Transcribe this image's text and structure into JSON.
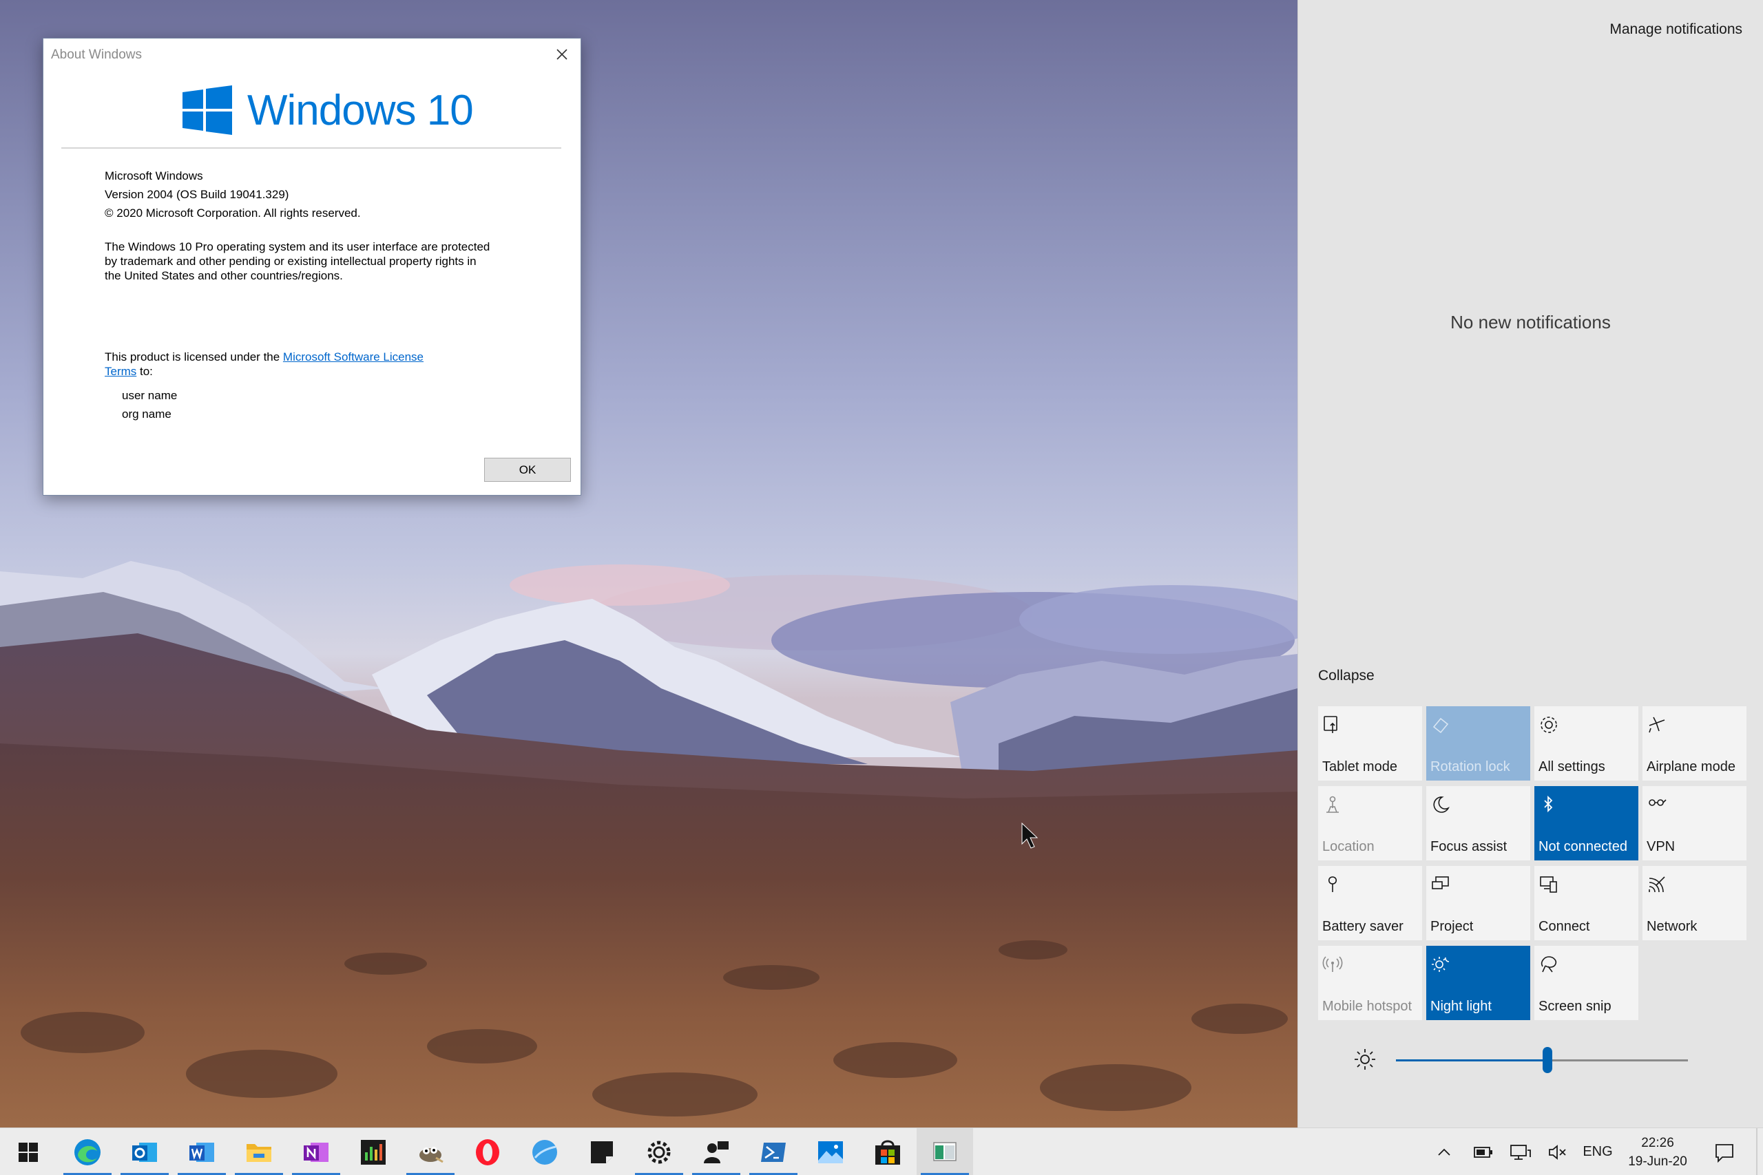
{
  "about_dialog": {
    "title": "About Windows",
    "logo_text": "Windows 10",
    "product": "Microsoft Windows",
    "version": "Version 2004 (OS Build 19041.329)",
    "copyright": "© 2020 Microsoft Corporation. All rights reserved.",
    "legal_line1": "The Windows 10 Pro operating system and its user interface are protected",
    "legal_line2": "by trademark and other pending or existing intellectual property rights in",
    "legal_line3": "the United States and other countries/regions.",
    "license_prefix": "This product is licensed under the ",
    "license_link_1": "Microsoft Software License",
    "license_link_2": "Terms",
    "license_suffix": " to:",
    "user_name": "user name",
    "org_name": "org name",
    "ok_label": "OK"
  },
  "action_center": {
    "manage_notifications": "Manage notifications",
    "no_notifications": "No new notifications",
    "collapse": "Collapse",
    "tiles": [
      {
        "label": "Tablet mode",
        "icon": "tablet-mode-icon",
        "state": "off"
      },
      {
        "label": "Rotation lock",
        "icon": "rotation-lock-icon",
        "state": "disabled-on"
      },
      {
        "label": "All settings",
        "icon": "gear-icon",
        "state": "off"
      },
      {
        "label": "Airplane mode",
        "icon": "airplane-icon",
        "state": "off"
      },
      {
        "label": "Location",
        "icon": "location-icon",
        "state": "disabled"
      },
      {
        "label": "Focus assist",
        "icon": "moon-icon",
        "state": "off"
      },
      {
        "label": "Not connected",
        "icon": "bluetooth-icon",
        "state": "on"
      },
      {
        "label": "VPN",
        "icon": "vpn-icon",
        "state": "off"
      },
      {
        "label": "Battery saver",
        "icon": "battery-saver-icon",
        "state": "off"
      },
      {
        "label": "Project",
        "icon": "project-icon",
        "state": "off"
      },
      {
        "label": "Connect",
        "icon": "connect-icon",
        "state": "off"
      },
      {
        "label": "Network",
        "icon": "network-icon",
        "state": "off"
      },
      {
        "label": "Mobile hotspot",
        "icon": "hotspot-icon",
        "state": "disabled"
      },
      {
        "label": "Night light",
        "icon": "night-light-icon",
        "state": "on"
      },
      {
        "label": "Screen snip",
        "icon": "screen-snip-icon",
        "state": "off"
      }
    ],
    "brightness_fraction": 0.52
  },
  "taskbar": {
    "apps": [
      "start",
      "edge",
      "outlook",
      "word",
      "file-explorer",
      "onenote",
      "task-manager",
      "gimp",
      "opera",
      "browser",
      "sticky-notes",
      "settings",
      "people",
      "powershell",
      "photos",
      "store",
      "app"
    ],
    "tray": {
      "language": "ENG",
      "time": "22:26",
      "date": "19-Jun-20"
    }
  },
  "colors": {
    "accent": "#0078d7",
    "tile_on": "#0063b1",
    "tile_disabled_on": "#8fb4d9",
    "link": "#0066cc"
  }
}
